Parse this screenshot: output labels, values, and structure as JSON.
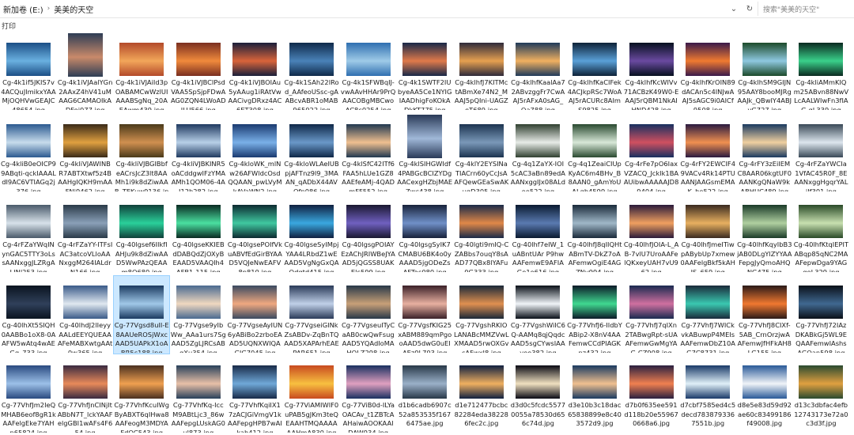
{
  "address_bar": {
    "path": [
      "新加卷 (E:)",
      "美美的天空"
    ],
    "search_placeholder": "搜索\"美美的天空\"",
    "dropdown_icon": "chevron-down-icon",
    "refresh_icon": "refresh-icon"
  },
  "toolbar": {
    "open_label": "打印"
  },
  "files": [
    {
      "name": "Cg-4k1if5JKIS7v4ACQuJImikxYAAMjOQHVwGEAJC48654.jpg",
      "tall": false,
      "c1": "#1c4f86",
      "c2": "#6ab0e0"
    },
    {
      "name": "Cg-4k1iVJAalYGn2AAxZ4hV41uMAAG6CAMAOIkADFoi077.jpg",
      "tall": true,
      "c1": "#2d3d55",
      "c2": "#c98a6a"
    },
    {
      "name": "Cg-4k1iVJAiId3pOABAMCwWzlUIAAABSgNq_20AEAwm439.jpg",
      "tall": false,
      "c1": "#b34a2a",
      "c2": "#f2a65a"
    },
    {
      "name": "Cg-4k1iVJBCIPsdVAA5SpSjpFDwAAG0ZQN4LWoADILU566.jpg",
      "tall": false,
      "c1": "#7a2f20",
      "c2": "#f08a3c"
    },
    {
      "name": "Cg-4k1iVJBOIAu5yAAug1iRAtVwAACivgDRxz4AC6ET308.jpg",
      "tall": false,
      "c1": "#1a1f3a",
      "c2": "#d9643a"
    },
    {
      "name": "Cg-4k1SAh22IRod_AAfeoUSsc-gAABcvABR1oMAB965022.jpg",
      "tall": false,
      "c1": "#0f2a4a",
      "c2": "#4a82b8"
    },
    {
      "name": "Cg-4k1SFWBqIJ-vwAAvHHAr9PrQAACOBgMBCwoAC8c0254.jpg",
      "tall": false,
      "c1": "#2f6fb0",
      "c2": "#9fcbe8"
    },
    {
      "name": "Cg-4k1SWTF2IUbyeAA5Ce1NYIGIAADhigFoKOkADkKT775.jpg",
      "tall": false,
      "c1": "#182848",
      "c2": "#e07a4a"
    },
    {
      "name": "Cg-4klhfJ7KITMctABmXe74N2_MAAJ5pQIni-UAGZeT689.jpg",
      "tall": false,
      "c1": "#2e2a3a",
      "c2": "#e6a050"
    },
    {
      "name": "Cg-4klhfKaalAa72ABvzggFr7CwAAJ5rAFxA0sAG_Oa788.jpg",
      "tall": false,
      "c1": "#1f3a5a",
      "c2": "#f0b060"
    },
    {
      "name": "Cg-4klhfKaCIFek4ACJkpRSc7WoAAJ5rACURc8AImS9825.jpg",
      "tall": false,
      "c1": "#0e2238",
      "c2": "#5aa0d8"
    },
    {
      "name": "Cg-4klhfKcWIVv71ACBzK49W0-EAAJ5rQBM1NkAIHND428.jpg",
      "tall": false,
      "c1": "#07101f",
      "c2": "#6a4aa0"
    },
    {
      "name": "Cg-4klhfKrOIN89dACAn5c4INJwAAJ5sAGC9i0AICf9508.jpg",
      "tall": false,
      "c1": "#3a1a4a",
      "c2": "#f07a30"
    },
    {
      "name": "Cg-4klhSM9GIJN95AAY8booMJRgAAJk_QBwIY4ABJyG727.jpg",
      "tall": false,
      "c1": "#1c4a2a",
      "c2": "#8ec8e0"
    },
    {
      "name": "Cg-4kliAMmKIQm25ABvn88NwVLcAALWIwFn3fIAG-gL339.jpg",
      "tall": false,
      "c1": "#0a2a20",
      "c2": "#3ad08a"
    },
    {
      "name": "Cg-4kliB0eOICP99ABqti-qckIAAALdI9AC6VTIAGq2j376.jpg",
      "tall": false,
      "c1": "#2c5a90",
      "c2": "#c8dcec"
    },
    {
      "name": "Cg-4kliVJAWINBR7ABTXtwf5z4BAAHgIQKH9mAAFNi9462.jpg",
      "tall": false,
      "c1": "#3a2a18",
      "c2": "#e0a040"
    },
    {
      "name": "Cg-4kliVJBGIBbfeACrsJcZ3lt8AAMh1i9k8dZiwAAB_TEKuw9136.jpg",
      "tall": false,
      "c1": "#4a3a1a",
      "c2": "#d09050"
    },
    {
      "name": "Cg-4kliVJBKINR5oACddgwIFzYMAAMh1QOM06-4AJ12b282.jpg",
      "tall": false,
      "c1": "#203a60",
      "c2": "#b8d0e8"
    },
    {
      "name": "Cg-4kloWK_mlNw26AFWldcOsdQQAAN_pwLVyMkAVaWN2.jpg",
      "tall": false,
      "c1": "#1a3a70",
      "c2": "#7ab0e8"
    },
    {
      "name": "Cg-4kloWLAeIUBpjAFTnz9l9_3MAAN_qADbX44AVOfn086.jpg",
      "tall": false,
      "c1": "#0f2848",
      "c2": "#6a98c8"
    },
    {
      "name": "Cg-4klSfC42ITf6FAA5hLUe1GZ8AAEfeAMj-4QADmFF552.jpg",
      "tall": false,
      "c1": "#203850",
      "c2": "#f0c090"
    },
    {
      "name": "Cg-4klSIHGWIdf4PABGcBCIZYDgAACexgHZbjMAEZwc438.jpg",
      "tall": true,
      "c1": "#2a3a58",
      "c2": "#a0b8d8"
    },
    {
      "name": "Cg-4klY2EYSINaTIACrn60yCcJsAAFQewGEaSwAKugD305.jpg",
      "tall": false,
      "c1": "#1c3450",
      "c2": "#7a98b8"
    },
    {
      "name": "Cg-4q1ZaYX-IOI5cAC3aBn89edAAANxggIJx08ALdoe522.jpg",
      "tall": false,
      "c1": "#304030",
      "c2": "#e8ece8"
    },
    {
      "name": "Cg-4q1ZeaiCIUpKyAC6m4BHv_B8AAN0_gAmYoUALqb4599.jpg",
      "tall": false,
      "c1": "#2a4a30",
      "c2": "#d8e8d8"
    },
    {
      "name": "Cg-4rFe7pO6IaxVZACQ_Jcklk1BAAUibwAAAAAJD89404.jpg",
      "tall": false,
      "c1": "#183060",
      "c2": "#d05060"
    },
    {
      "name": "Cg-4rFY2EWCIF49VACv4Rk14PTUAANJAAGsmEMAK_he522.jpg",
      "tall": false,
      "c1": "#2a1a40",
      "c2": "#f09050"
    },
    {
      "name": "Cg-4rFY3zEiIEMC8AAR06kgtUF0AANKgQNaW9kABHUC489.jpg",
      "tall": false,
      "c1": "#1a3a60",
      "c2": "#f0d0a0"
    },
    {
      "name": "Cg-4rFZaYWCIa1VfAC45R0F_8EAANxggHgqrYALjIf301.jpg",
      "tall": false,
      "c1": "#3a4a58",
      "c2": "#dde6ee"
    },
    {
      "name": "Cg-4rFZaYWqINynGAC5TTY3oLssAANxggJLZRgALINl253.jpg",
      "tall": false,
      "c1": "#4a5a6a",
      "c2": "#d8e2ea"
    },
    {
      "name": "Cg-4rFZaYY-ITFsIAC3atcoVLloAANxggM264IALdrN166.jpg",
      "tall": false,
      "c1": "#2a3a48",
      "c2": "#8aa0b8"
    },
    {
      "name": "Cg-40lgsef6IIkfIAHJu9k8dZiwAAD5WwPAzQEAAm8O680.jpg",
      "tall": false,
      "c1": "#10403a",
      "c2": "#2ad09a"
    },
    {
      "name": "Cg-40lgseKKIEBdDABQdZjOXyBEAAD5VAAQIh4AFB1-115.jpg",
      "tall": false,
      "c1": "#0a2a22",
      "c2": "#4ae0a0"
    },
    {
      "name": "Cg-40lgsePOIfVkuABVfEdGirBYAAD5VQJeNwEAFV8p810.jpg",
      "tall": false,
      "c1": "#0c2a30",
      "c2": "#40c8a0"
    },
    {
      "name": "Cg-40lgseSyIMpjYAA4LRbdZ1wEAAD5VgNgGxQAQdgtd415.jpg",
      "tall": false,
      "c1": "#102040",
      "c2": "#3aa8e0"
    },
    {
      "name": "Cg-40lgsgPOIAYEzAChJRIWBeJYAAD5jQGSS8UAKElc599.jpg",
      "tall": false,
      "c1": "#1a1830",
      "c2": "#7060c0"
    },
    {
      "name": "Cg-40lgsgSyIK7CMABU6BK4o0yAAAD5jgODeZsAFToc080.jpg",
      "tall": false,
      "c1": "#18223a",
      "c2": "#7090c8"
    },
    {
      "name": "Cg-40lgti9mIQ-CZABbs7ouqY8sAAD77QBx8lYAFu0G333.jpg",
      "tall": false,
      "c1": "#1a2a48",
      "c2": "#e08848"
    },
    {
      "name": "Cg-40lhf7eIW_1uABntUAr P9hwAAFemwE9AFIAGe1o616.jpg",
      "tall": false,
      "c1": "#0a1a30",
      "c2": "#5a7ab0"
    },
    {
      "name": "Cg-40lhfJ8qIIQHtABmTV-DkZ7oAAFemwOgiE4AGZNv994.jpg",
      "tall": false,
      "c1": "#1a2a3a",
      "c2": "#a0b8c8"
    },
    {
      "name": "Cg-40lhfJOIA-L_AB-7vlU7UroAAFelQKxeyUAH7vU962.jpg",
      "tall": false,
      "c1": "#2a1a3a",
      "c2": "#f0a060"
    },
    {
      "name": "Cg-40lhfJmeITiwpABybUp7xmew0AAFelgBkf5kAHJS_659.jpg",
      "tall": false,
      "c1": "#3a2a20",
      "c2": "#e8b060"
    },
    {
      "name": "Cg-40lhfKqyIbB3jAB0DLgYlZYYAAFepgJyQmoAHQNG475.jpg",
      "tall": false,
      "c1": "#1a3a28",
      "c2": "#b0d0a0"
    },
    {
      "name": "Cg-40lhfKtqIEPITABqp85qNC2MAAFepwDga9YAGqoL329.jpg",
      "tall": false,
      "c1": "#2a4a28",
      "c2": "#c8e0b0"
    },
    {
      "name": "Cg-40lhXt5SIQH0AABBo1oX8-0AAFW5wAtq4wAEGg_733.jpg",
      "tall": false,
      "c1": "#0a1420",
      "c2": "#30405a"
    },
    {
      "name": "Cg-40lhdJ2lIeyyAALdEEYQUEAAAFeMABXwtgAAt0w365.jpg",
      "tall": false,
      "c1": "#3a5a88",
      "c2": "#e0e8f0"
    },
    {
      "name": "Cg-77Vgsd8uII-E8AAUeROSjWxcAAD5UAPkX1oABR5c188.jpg",
      "tall": false,
      "c1": "#1a3a60",
      "c2": "#a0c8e8"
    },
    {
      "name": "Cg-77Vgse9yIbWw_AAa1urs7SgAAD5ZgLJRCsABqXu354.jpg",
      "tall": false,
      "c1": "#4a6a90",
      "c2": "#f0d8c0"
    },
    {
      "name": "Cg-77VgseAyIUN6yABiBo2zrboEAAD5UQNXWIQAGIG7045.jpg",
      "tall": false,
      "c1": "#3a4a60",
      "c2": "#f0a880"
    },
    {
      "name": "Cg-77VgseiGINkZsABDv-ZqBnTQAAD5XAPArhEAEPAR651.jpg",
      "tall": false,
      "c1": "#2a3a58",
      "c2": "#c0d0e8"
    },
    {
      "name": "Cg-77VgseuITyCaAB0cwQwFsugAAD5YQAdIoMAHQLZ298.jpg",
      "tall": false,
      "c1": "#283848",
      "c2": "#c8a078"
    },
    {
      "name": "Cg-77VgsfKIG25xABM889qmPgooAAD5dwG0uEIAEz0L703.jpg",
      "tall": false,
      "c1": "#3a2028",
      "c2": "#e8b0a0"
    },
    {
      "name": "Cg-77VgshRKIOLANABcMMZVwLXMAAD5rwOXGvcAFwxJ8.jpg",
      "tall": false,
      "c1": "#1a2838",
      "c2": "#e09050"
    },
    {
      "name": "Cg-77VgshWiIC6Q-AAMq8qjQqdcAAD5sgCYwsIAAyoe382.jpg",
      "tall": false,
      "c1": "#0a1018",
      "c2": "#f0f4f8"
    },
    {
      "name": "Cg-77VhfJ6-IIdbYABip2-X8nV4AAFemwCCdPIAGKnz432.jpg",
      "tall": false,
      "c1": "#0c1a28",
      "c2": "#40d890"
    },
    {
      "name": "Cg-77VhfJ7qIXn2TABwgRpt-sUAAFemwGwMgYAG-CZ908.jpg",
      "tall": false,
      "c1": "#1a2a50",
      "c2": "#d070a0"
    },
    {
      "name": "Cg-77VhfJ7WICkvkABuwpP4MEIsAAFemwDbZ10AG7C8731.jpg",
      "tall": false,
      "c1": "#1a2a3a",
      "c2": "#3ac8b0"
    },
    {
      "name": "Cg-77VhfJ8CIXf-5AB_CrnOrzjwAAFemwJfHFkAH8LG155.jpg",
      "tall": false,
      "c1": "#2a1a18",
      "c2": "#f07830"
    },
    {
      "name": "Cg-77VhfJ72IAzDKABkGj5WL9EQAAFemwIAshsAGQan598.jpg",
      "tall": false,
      "c1": "#0a1018",
      "c2": "#406890"
    },
    {
      "name": "Cg-77VhfJm2IeQMHAB6eof8gR1kAAFelgEke7YAHp65824.jpg",
      "tall": false,
      "c1": "#2a4a80",
      "c2": "#9cc0e8"
    },
    {
      "name": "Cg-77VhfJnCINjltABbN7T_lckYAAFelgGBI1wAFs4F654.jpg",
      "tall": false,
      "c1": "#3a2a40",
      "c2": "#e88a5a"
    },
    {
      "name": "Cg-77VhfKcuIWgByABXT6qIHwa8AAFeogM3MDYAFdQC543.jpg",
      "tall": false,
      "c1": "#4a3020",
      "c2": "#f0a050"
    },
    {
      "name": "Cg-77VhfKq-IccM9ABtLjc3_86wAAFepgLUskAG0ul873.jpg",
      "tall": false,
      "c1": "#28405a",
      "c2": "#e8c0a8"
    },
    {
      "name": "Cg-77VhfKqiIX17zACJGiVmgV1kAAFepgHPB7wAIkah412.jpg",
      "tall": false,
      "c1": "#182a48",
      "c2": "#70a8d8"
    },
    {
      "name": "Cg-77ViAMIWIF0uPAB5gJKm3teQEAAHTMQAAAAAAHmA830.jpg",
      "tall": false,
      "c1": "#c84a20",
      "c2": "#f8c040"
    },
    {
      "name": "Cg-77ViB0d-ILYaOACAv_t1ZBTcAAHaiwAOOKAAIDAW934.jpg",
      "tall": false,
      "c1": "#1a3060",
      "c2": "#e0a0c0"
    },
    {
      "name": "d1b6cadb6907c52a853535f1676475ae.jpg",
      "tall": false,
      "c1": "#283848",
      "c2": "#9ab0c8"
    },
    {
      "name": "d1e712477bcbc82284eda382286fec2c.jpg",
      "tall": false,
      "c1": "#102040",
      "c2": "#f0b060"
    },
    {
      "name": "d3d0c5fcdc55770055a78530d656c74d.jpg",
      "tall": false,
      "c1": "#0a0a14",
      "c2": "#f0e0c0"
    },
    {
      "name": "d3e10b3c18dac65838899e8c403572d9.jpg",
      "tall": false,
      "c1": "#1a3a60",
      "c2": "#f0c090"
    },
    {
      "name": "d7b0f635ee591d118b20e559670668a6.jpg",
      "tall": false,
      "c1": "#2a2040",
      "c2": "#f08050"
    },
    {
      "name": "d7cbf7585ed4c5decd7838793367551b.jpg",
      "tall": false,
      "c1": "#1a3a68",
      "c2": "#e0f0f8"
    },
    {
      "name": "d8e5e83d59d92ae60c83499186f49008.jpg",
      "tall": false,
      "c1": "#2a5a98",
      "c2": "#f0f4f8"
    },
    {
      "name": "d13c3dbfac4efb12743173e72a0c3d3f.jpg",
      "tall": false,
      "c1": "#2a4a30",
      "c2": "#e0a040"
    }
  ],
  "selected_index": 47
}
